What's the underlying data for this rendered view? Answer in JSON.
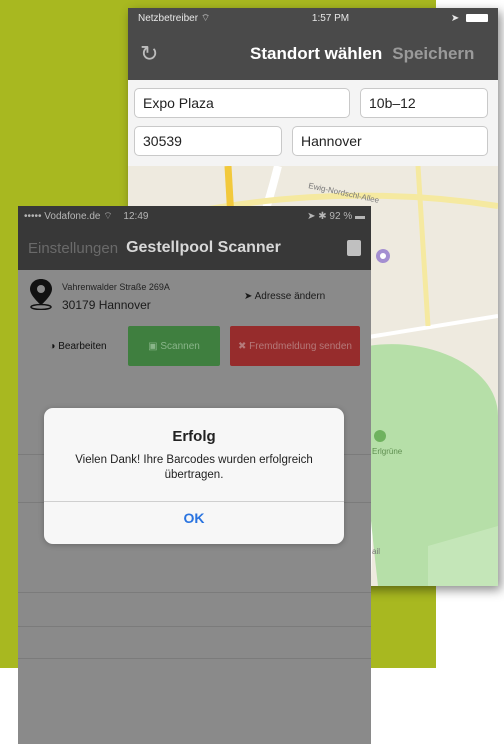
{
  "back_screen": {
    "status": {
      "carrier": "Netzbetreiber",
      "time": "1:57 PM"
    },
    "nav": {
      "refresh_icon": "refresh-icon",
      "title": "Standort wählen",
      "save_label": "Speichern"
    },
    "form": {
      "street": "Expo Plaza",
      "number": "10b–12",
      "postcode": "30539",
      "city": "Hannover"
    },
    "map": {
      "road_label": "Ewig-Nordschl-Allee",
      "park_label": "Erlgrüne",
      "partial_label": "ail"
    }
  },
  "front_screen": {
    "status": {
      "carrier": "••••• Vodafone.de",
      "time": "12:49",
      "battery": "92 %"
    },
    "nav": {
      "back_label": "Einstellungen",
      "title": "Gestellpool Scanner"
    },
    "address": {
      "street": "Vahrenwalder Straße 269A",
      "city": "30179 Hannover",
      "change_label": "Adresse ändern"
    },
    "actions": {
      "edit_label": "Bearbeiten",
      "scan_label": "Scannen",
      "error_label": "Fremdmeldung senden"
    }
  },
  "alert": {
    "title": "Erfolg",
    "message": "Vielen Dank! Ihre Barcodes wurden erfolgreich übertragen.",
    "ok_label": "OK"
  },
  "colors": {
    "background_green": "#a8b820",
    "scan_green": "#3f7f3f",
    "error_red": "#962c2c",
    "link_blue": "#2a74e0"
  }
}
